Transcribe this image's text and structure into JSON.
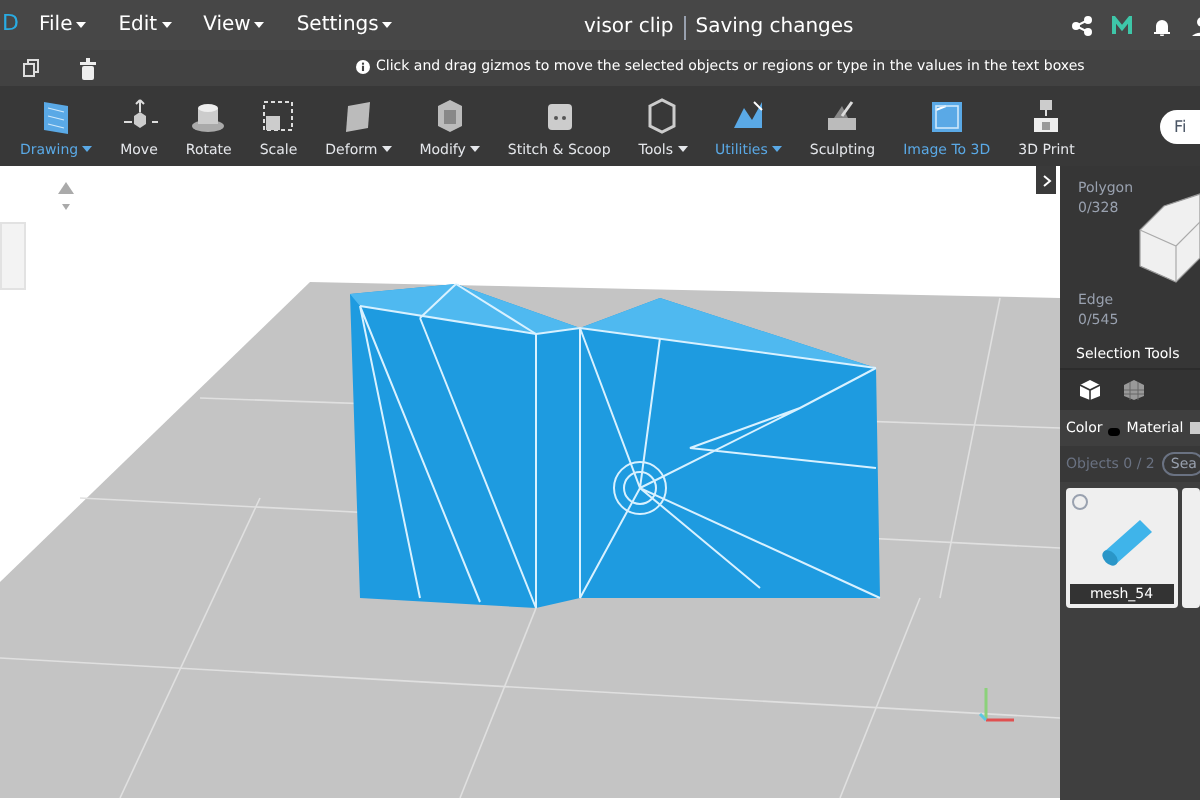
{
  "menu_bar": {
    "logo_text": "D",
    "menus": [
      {
        "label": "File",
        "dropdown": true
      },
      {
        "label": "Edit",
        "dropdown": true
      },
      {
        "label": "View",
        "dropdown": true
      },
      {
        "label": "Settings",
        "dropdown": true
      }
    ],
    "document_title": "visor clip",
    "save_status": "Saving changes"
  },
  "hint_bar": {
    "message": "Click and drag gizmos to move the selected objects or regions or type in the values in the text boxes"
  },
  "toolbar": {
    "tools": [
      {
        "label": "Drawing",
        "highlighted": true,
        "dropdown": true
      },
      {
        "label": "Move",
        "highlighted": false,
        "dropdown": false
      },
      {
        "label": "Rotate",
        "highlighted": false,
        "dropdown": false
      },
      {
        "label": "Scale",
        "highlighted": false,
        "dropdown": false
      },
      {
        "label": "Deform",
        "highlighted": false,
        "dropdown": true
      },
      {
        "label": "Modify",
        "highlighted": false,
        "dropdown": true
      },
      {
        "label": "Stitch & Scoop",
        "highlighted": false,
        "dropdown": false
      },
      {
        "label": "Tools",
        "highlighted": false,
        "dropdown": true
      },
      {
        "label": "Utilities",
        "highlighted": true,
        "dropdown": true
      },
      {
        "label": "Sculpting",
        "highlighted": false,
        "dropdown": false
      },
      {
        "label": "Image To 3D",
        "highlighted": true,
        "dropdown": false
      },
      {
        "label": "3D Print",
        "highlighted": false,
        "dropdown": false
      }
    ],
    "search": {
      "placeholder": "Fi"
    }
  },
  "side_panel": {
    "polygon_label": "Polygon",
    "polygon_count": "0/328",
    "edge_label": "Edge",
    "edge_count": "0/545",
    "section_title": "Selection Tools",
    "color_label": "Color",
    "material_label": "Material",
    "objects_count": "Objects 0 / 2",
    "search_button": "Sea",
    "objects": [
      {
        "name": "mesh_54"
      }
    ]
  }
}
